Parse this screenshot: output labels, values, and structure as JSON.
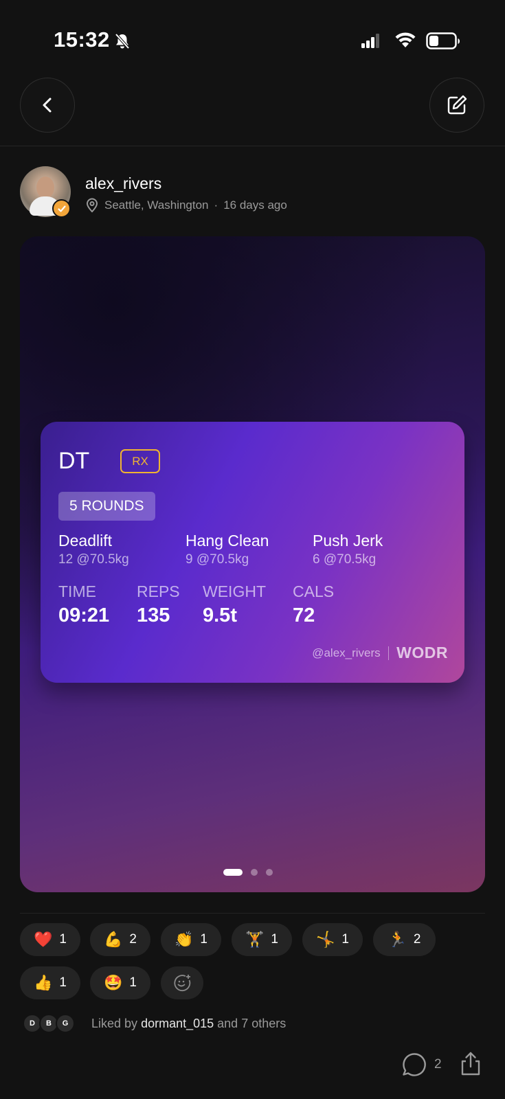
{
  "status_bar": {
    "time": "15:32"
  },
  "author": {
    "username": "alex_rivers",
    "location": "Seattle, Washington",
    "separator": "·",
    "time_ago": "16 days ago"
  },
  "workout": {
    "title": "DT",
    "badge": "RX",
    "rounds": "5 ROUNDS",
    "movements": [
      {
        "name": "Deadlift",
        "detail": "12  @70.5kg"
      },
      {
        "name": "Hang Clean",
        "detail": "9  @70.5kg"
      },
      {
        "name": "Push Jerk",
        "detail": "6  @70.5kg"
      }
    ],
    "stats": [
      {
        "label": "TIME",
        "value": "09:21"
      },
      {
        "label": "REPS",
        "value": "135"
      },
      {
        "label": "WEIGHT",
        "value": "9.5t"
      },
      {
        "label": "CALS",
        "value": "72"
      }
    ],
    "handle": "@alex_rivers",
    "brand": "WODR"
  },
  "pager": {
    "current_page": 1,
    "total_pages": 3
  },
  "reactions": [
    {
      "icon": "heart-icon",
      "emoji": "❤️",
      "count": "1"
    },
    {
      "icon": "flexed-biceps-icon",
      "emoji": "💪",
      "count": "2"
    },
    {
      "icon": "clapping-hands-icon",
      "emoji": "👏",
      "count": "1"
    },
    {
      "icon": "weightlifter-icon",
      "emoji": "🏋",
      "count": "1"
    },
    {
      "icon": "gymnast-icon",
      "emoji": "🤸",
      "count": "1"
    },
    {
      "icon": "runner-icon",
      "emoji": "🏃",
      "count": "2"
    },
    {
      "icon": "thumbs-up-icon",
      "emoji": "👍",
      "count": "1"
    },
    {
      "icon": "star-struck-icon",
      "emoji": "🤩",
      "count": "1"
    }
  ],
  "likes": {
    "avatars": [
      "D",
      "B",
      "G"
    ],
    "prefix": "Liked by",
    "user": "dormant_015",
    "suffix": "and 7 others"
  },
  "comments": {
    "count": "2"
  },
  "colors": {
    "background": "#121212",
    "rx_badge": "#f0b430",
    "verified": "#f2a53a"
  }
}
